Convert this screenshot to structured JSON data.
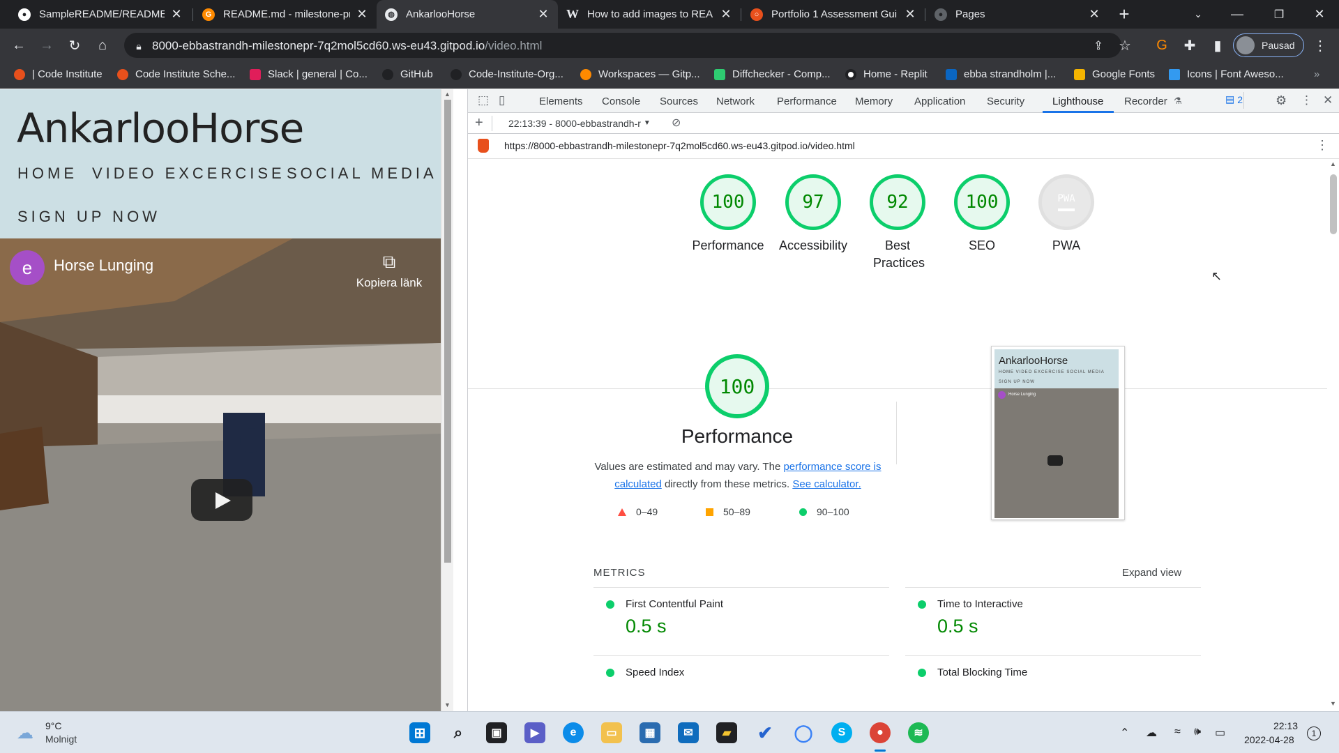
{
  "browser": {
    "tabs": [
      {
        "label": "SampleREADME/README.m",
        "icon": "github-icon",
        "active": false
      },
      {
        "label": "README.md - milestone-pr",
        "icon": "gitpod-icon",
        "active": false
      },
      {
        "label": "AnkarlooHorse",
        "icon": "globe-icon",
        "active": true
      },
      {
        "label": "How to add images to REA",
        "icon": "wikipedia-icon",
        "active": false
      },
      {
        "label": "Portfolio 1 Assessment Gui",
        "icon": "code-institute-icon",
        "active": false
      },
      {
        "label": "Pages",
        "icon": "github-icon",
        "active": false
      }
    ],
    "url_host": "8000-ebbastrandh-milestonepr-7q2mol5cd60.ws-eu43.gitpod.io",
    "url_path": "/video.html",
    "profile_label": "Pausad",
    "bookmarks": [
      "| Code Institute",
      "Code Institute Sche...",
      "Slack | general | Co...",
      "GitHub",
      "Code-Institute-Org...",
      "Workspaces — Gitp...",
      "Diffchecker - Comp...",
      "Home - Replit",
      "ebba strandholm |...",
      "Google Fonts",
      "Icons | Font Aweso..."
    ]
  },
  "site": {
    "brand": "AnkarlooHorse",
    "nav": [
      "HOME",
      "VIDEO EXCERCISE",
      "SOCIAL MEDIA",
      "SIGN UP NOW"
    ],
    "video": {
      "channel_initial": "e",
      "title": "Horse Lunging",
      "copy_link": "Kopiera länk"
    }
  },
  "devtools": {
    "tabs": [
      "Elements",
      "Console",
      "Sources",
      "Network",
      "Performance",
      "Memory",
      "Application",
      "Security",
      "Lighthouse",
      "Recorder"
    ],
    "active_tab": "Lighthouse",
    "issues_count": "2",
    "report_select": "22:13:39 - 8000-ebbastrandh-r",
    "report_url": "https://8000-ebbastrandh-milestonepr-7q2mol5cd60.ws-eu43.gitpod.io/video.html"
  },
  "lighthouse": {
    "scores": [
      {
        "value": "100",
        "label": "Performance"
      },
      {
        "value": "97",
        "label": "Accessibility"
      },
      {
        "value": "92",
        "label": "Best Practices"
      },
      {
        "value": "100",
        "label": "SEO"
      },
      {
        "value": "PWA",
        "label": "PWA"
      }
    ],
    "performance": {
      "score": "100",
      "title": "Performance",
      "explain_prefix": "Values are estimated and may vary. The ",
      "explain_link1": "performance score is calculated",
      "explain_mid": " directly from these metrics. ",
      "explain_link2": "See calculator.",
      "legend": [
        "0–49",
        "50–89",
        "90–100"
      ]
    },
    "thumb": {
      "brand": "AnkarlooHorse",
      "nav": "HOME  VIDEO EXCERCISE  SOCIAL MEDIA",
      "signup": "SIGN UP NOW",
      "video_title": "Horse Lunging"
    },
    "metrics_label": "METRICS",
    "expand_label": "Expand view",
    "metrics": [
      {
        "name": "First Contentful Paint",
        "value": "0.5 s"
      },
      {
        "name": "Time to Interactive",
        "value": "0.5 s"
      },
      {
        "name": "Speed Index",
        "value": ""
      },
      {
        "name": "Total Blocking Time",
        "value": ""
      }
    ]
  },
  "taskbar": {
    "weather_temp": "9°C",
    "weather_desc": "Molnigt",
    "time": "22:13",
    "date": "2022-04-28",
    "notifications": "1"
  },
  "colors": {
    "pass": "#0cce6b",
    "average": "#ffa400",
    "fail": "#ff4e42",
    "accent": "#1a73e8"
  }
}
